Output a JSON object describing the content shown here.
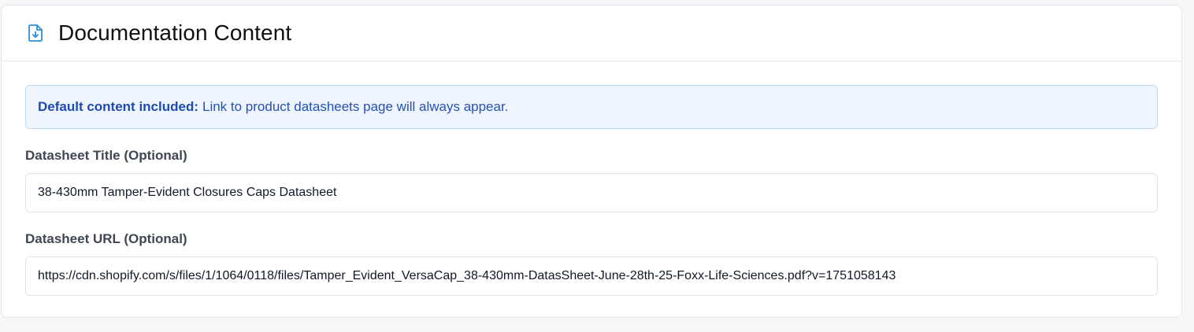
{
  "panel": {
    "icon": "file-download-icon",
    "title": "Documentation Content",
    "accent_color": "#2d8fd5"
  },
  "notice": {
    "strong_text": "Default content included:",
    "text": "Link to product datasheets page will always appear."
  },
  "fields": {
    "datasheet_title": {
      "label": "Datasheet Title (Optional)",
      "value": "38-430mm Tamper-Evident Closures Caps Datasheet"
    },
    "datasheet_url": {
      "label": "Datasheet URL (Optional)",
      "value": "https://cdn.shopify.com/s/files/1/1064/0118/files/Tamper_Evident_VersaCap_38-430mm-DatasSheet-June-28th-25-Foxx-Life-Sciences.pdf?v=1751058143"
    }
  }
}
